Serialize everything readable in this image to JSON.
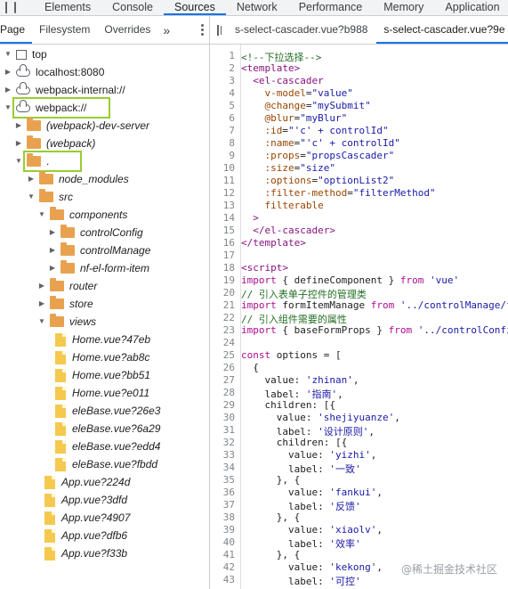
{
  "devtools_tabs": [
    "Elements",
    "Console",
    "Sources",
    "Network",
    "Performance",
    "Memory",
    "Application"
  ],
  "active_devtools_tab": "Sources",
  "navigator": {
    "tabs": [
      "Page",
      "Filesystem",
      "Overrides"
    ],
    "more": "»",
    "tree": [
      {
        "label": "top",
        "icon": "frame-icon",
        "depth": 0,
        "expanded": true,
        "italic": false
      },
      {
        "label": "localhost:8080",
        "icon": "cloud-icon",
        "depth": 0,
        "expanded": false,
        "italic": false
      },
      {
        "label": "webpack-internal://",
        "icon": "cloud-icon",
        "depth": 0,
        "expanded": false,
        "italic": false
      },
      {
        "label": "webpack://",
        "icon": "cloud-icon",
        "depth": 0,
        "expanded": true,
        "italic": false,
        "highlight": true
      },
      {
        "label": "(webpack)-dev-server",
        "icon": "folder-icon",
        "depth": 1,
        "expanded": false,
        "italic": true
      },
      {
        "label": "(webpack)",
        "icon": "folder-icon",
        "depth": 1,
        "expanded": false,
        "italic": true
      },
      {
        "label": ".",
        "icon": "folder-icon",
        "depth": 1,
        "expanded": true,
        "italic": false,
        "highlight": true
      },
      {
        "label": "node_modules",
        "icon": "folder-icon",
        "depth": 2,
        "expanded": false,
        "italic": true
      },
      {
        "label": "src",
        "icon": "folder-icon",
        "depth": 2,
        "expanded": true,
        "italic": true
      },
      {
        "label": "components",
        "icon": "folder-icon",
        "depth": 3,
        "expanded": true,
        "italic": true
      },
      {
        "label": "controlConfig",
        "icon": "folder-icon",
        "depth": 4,
        "expanded": false,
        "italic": true
      },
      {
        "label": "controlManage",
        "icon": "folder-icon",
        "depth": 4,
        "expanded": false,
        "italic": true
      },
      {
        "label": "nf-el-form-item",
        "icon": "folder-icon",
        "depth": 4,
        "expanded": false,
        "italic": true
      },
      {
        "label": "router",
        "icon": "folder-icon",
        "depth": 3,
        "expanded": false,
        "italic": true
      },
      {
        "label": "store",
        "icon": "folder-icon",
        "depth": 3,
        "expanded": false,
        "italic": true
      },
      {
        "label": "views",
        "icon": "folder-icon",
        "depth": 3,
        "expanded": true,
        "italic": true
      },
      {
        "label": "Home.vue?47eb",
        "icon": "file-icon",
        "depth": 4,
        "italic": true
      },
      {
        "label": "Home.vue?ab8c",
        "icon": "file-icon",
        "depth": 4,
        "italic": true
      },
      {
        "label": "Home.vue?bb51",
        "icon": "file-icon",
        "depth": 4,
        "italic": true
      },
      {
        "label": "Home.vue?e011",
        "icon": "file-icon",
        "depth": 4,
        "italic": true
      },
      {
        "label": "eleBase.vue?26e3",
        "icon": "file-icon",
        "depth": 4,
        "italic": true
      },
      {
        "label": "eleBase.vue?6a29",
        "icon": "file-icon",
        "depth": 4,
        "italic": true
      },
      {
        "label": "eleBase.vue?edd4",
        "icon": "file-icon",
        "depth": 4,
        "italic": true
      },
      {
        "label": "eleBase.vue?fbdd",
        "icon": "file-icon",
        "depth": 4,
        "italic": true
      },
      {
        "label": "App.vue?224d",
        "icon": "file-icon",
        "depth": 3,
        "italic": true
      },
      {
        "label": "App.vue?3dfd",
        "icon": "file-icon",
        "depth": 3,
        "italic": true
      },
      {
        "label": "App.vue?4907",
        "icon": "file-icon",
        "depth": 3,
        "italic": true
      },
      {
        "label": "App.vue?dfb6",
        "icon": "file-icon",
        "depth": 3,
        "italic": true
      },
      {
        "label": "App.vue?f33b",
        "icon": "file-icon",
        "depth": 3,
        "italic": true
      }
    ]
  },
  "editor": {
    "file_tabs": [
      "s-select-cascader.vue?b988",
      "s-select-cascader.vue?9e"
    ],
    "active_file_tab": 1,
    "lines": [
      {
        "n": "1",
        "tokens": [
          [
            "com",
            "<!--下拉选择-->"
          ]
        ]
      },
      {
        "n": "2",
        "tokens": [
          [
            "tag",
            "<template>"
          ]
        ]
      },
      {
        "n": "3",
        "tokens": [
          [
            "pun",
            "  "
          ],
          [
            "tag",
            "<el-cascader"
          ]
        ]
      },
      {
        "n": "4",
        "tokens": [
          [
            "pun",
            "    "
          ],
          [
            "attr",
            "v-model"
          ],
          [
            "pun",
            "="
          ],
          [
            "str",
            "\"value\""
          ]
        ]
      },
      {
        "n": "5",
        "tokens": [
          [
            "pun",
            "    "
          ],
          [
            "attr",
            "@change"
          ],
          [
            "pun",
            "="
          ],
          [
            "str",
            "\"mySubmit\""
          ]
        ]
      },
      {
        "n": "6",
        "tokens": [
          [
            "pun",
            "    "
          ],
          [
            "attr",
            "@blur"
          ],
          [
            "pun",
            "="
          ],
          [
            "str",
            "\"myBlur\""
          ]
        ]
      },
      {
        "n": "7",
        "tokens": [
          [
            "pun",
            "    "
          ],
          [
            "attr",
            ":id"
          ],
          [
            "pun",
            "="
          ],
          [
            "str",
            "\"'c' + controlId\""
          ]
        ]
      },
      {
        "n": "8",
        "tokens": [
          [
            "pun",
            "    "
          ],
          [
            "attr",
            ":name"
          ],
          [
            "pun",
            "="
          ],
          [
            "str",
            "\"'c' + controlId\""
          ]
        ]
      },
      {
        "n": "9",
        "tokens": [
          [
            "pun",
            "    "
          ],
          [
            "attr",
            ":props"
          ],
          [
            "pun",
            "="
          ],
          [
            "str",
            "\"propsCascader\""
          ]
        ]
      },
      {
        "n": "10",
        "tokens": [
          [
            "pun",
            "    "
          ],
          [
            "attr",
            ":size"
          ],
          [
            "pun",
            "="
          ],
          [
            "str",
            "\"size\""
          ]
        ]
      },
      {
        "n": "11",
        "tokens": [
          [
            "pun",
            "    "
          ],
          [
            "attr",
            ":options"
          ],
          [
            "pun",
            "="
          ],
          [
            "str",
            "\"optionList2\""
          ]
        ]
      },
      {
        "n": "12",
        "tokens": [
          [
            "pun",
            "    "
          ],
          [
            "attr",
            ":filter-method"
          ],
          [
            "pun",
            "="
          ],
          [
            "str",
            "\"filterMethod\""
          ]
        ]
      },
      {
        "n": "13",
        "tokens": [
          [
            "pun",
            "    "
          ],
          [
            "attr",
            "filterable"
          ]
        ]
      },
      {
        "n": "14",
        "tokens": [
          [
            "pun",
            "  "
          ],
          [
            "tag",
            ">"
          ]
        ]
      },
      {
        "n": "15",
        "tokens": [
          [
            "pun",
            "  "
          ],
          [
            "tag",
            "</el-cascader>"
          ]
        ]
      },
      {
        "n": "16",
        "tokens": [
          [
            "tag",
            "</template>"
          ]
        ]
      },
      {
        "n": "17",
        "tokens": []
      },
      {
        "n": "18",
        "tokens": [
          [
            "tag",
            "<script>"
          ]
        ]
      },
      {
        "n": "19",
        "tokens": [
          [
            "kw",
            "import"
          ],
          [
            "pun",
            " { defineComponent } "
          ],
          [
            "kw",
            "from"
          ],
          [
            "pun",
            " "
          ],
          [
            "str",
            "'vue'"
          ]
        ]
      },
      {
        "n": "20",
        "tokens": [
          [
            "com",
            "// 引入表单子控件的管理类"
          ]
        ]
      },
      {
        "n": "21",
        "tokens": [
          [
            "kw",
            "import"
          ],
          [
            "pun",
            " formItemManage "
          ],
          [
            "kw",
            "from"
          ],
          [
            "pun",
            " "
          ],
          [
            "str",
            "'../controlManage/f"
          ]
        ]
      },
      {
        "n": "22",
        "tokens": [
          [
            "com",
            "// 引入组件需要的属性"
          ]
        ]
      },
      {
        "n": "23",
        "tokens": [
          [
            "kw",
            "import"
          ],
          [
            "pun",
            " { baseFormProps } "
          ],
          [
            "kw",
            "from"
          ],
          [
            "pun",
            " "
          ],
          [
            "str",
            "'../controlConfi"
          ]
        ]
      },
      {
        "n": "24",
        "tokens": []
      },
      {
        "n": "25",
        "tokens": [
          [
            "kw",
            "const"
          ],
          [
            "pun",
            " options = ["
          ]
        ]
      },
      {
        "n": "26",
        "tokens": [
          [
            "pun",
            "  {"
          ]
        ]
      },
      {
        "n": "27",
        "tokens": [
          [
            "pun",
            "    value: "
          ],
          [
            "str",
            "'zhinan'"
          ],
          [
            "pun",
            ","
          ]
        ]
      },
      {
        "n": "28",
        "tokens": [
          [
            "pun",
            "    label: "
          ],
          [
            "str",
            "'指南'"
          ],
          [
            "pun",
            ","
          ]
        ]
      },
      {
        "n": "29",
        "tokens": [
          [
            "pun",
            "    children: [{"
          ]
        ]
      },
      {
        "n": "30",
        "tokens": [
          [
            "pun",
            "      value: "
          ],
          [
            "str",
            "'shejiyuanze'"
          ],
          [
            "pun",
            ","
          ]
        ]
      },
      {
        "n": "31",
        "tokens": [
          [
            "pun",
            "      label: "
          ],
          [
            "str",
            "'设计原则'"
          ],
          [
            "pun",
            ","
          ]
        ]
      },
      {
        "n": "32",
        "tokens": [
          [
            "pun",
            "      children: [{"
          ]
        ]
      },
      {
        "n": "33",
        "tokens": [
          [
            "pun",
            "        value: "
          ],
          [
            "str",
            "'yizhi'"
          ],
          [
            "pun",
            ","
          ]
        ]
      },
      {
        "n": "34",
        "tokens": [
          [
            "pun",
            "        label: "
          ],
          [
            "str",
            "'一致'"
          ]
        ]
      },
      {
        "n": "35",
        "tokens": [
          [
            "pun",
            "      }, {"
          ]
        ]
      },
      {
        "n": "36",
        "tokens": [
          [
            "pun",
            "        value: "
          ],
          [
            "str",
            "'fankui'"
          ],
          [
            "pun",
            ","
          ]
        ]
      },
      {
        "n": "37",
        "tokens": [
          [
            "pun",
            "        label: "
          ],
          [
            "str",
            "'反馈'"
          ]
        ]
      },
      {
        "n": "38",
        "tokens": [
          [
            "pun",
            "      }, {"
          ]
        ]
      },
      {
        "n": "39",
        "tokens": [
          [
            "pun",
            "        value: "
          ],
          [
            "str",
            "'xiaolv'"
          ],
          [
            "pun",
            ","
          ]
        ]
      },
      {
        "n": "40",
        "tokens": [
          [
            "pun",
            "        label: "
          ],
          [
            "str",
            "'效率'"
          ]
        ]
      },
      {
        "n": "41",
        "tokens": [
          [
            "pun",
            "      }, {"
          ]
        ]
      },
      {
        "n": "42",
        "tokens": [
          [
            "pun",
            "        value: "
          ],
          [
            "str",
            "'kekong'"
          ],
          [
            "pun",
            ","
          ]
        ]
      },
      {
        "n": "43",
        "tokens": [
          [
            "pun",
            "        label: "
          ],
          [
            "str",
            "'可控'"
          ]
        ]
      }
    ]
  },
  "watermark": "@稀土掘金技术社区",
  "colors": {
    "highlight_box": "#9acd32",
    "accent": "#1a73e8",
    "folder": "#e8a24f",
    "file": "#f4c94e"
  }
}
